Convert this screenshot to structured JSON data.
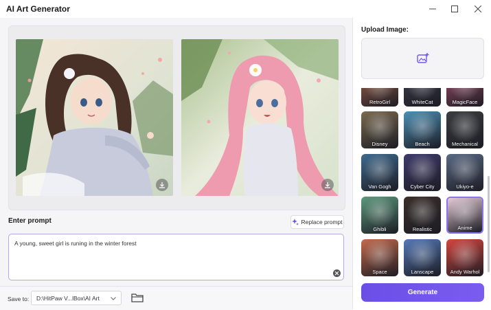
{
  "window": {
    "title": "AI Art Generator"
  },
  "prompt": {
    "label": "Enter prompt",
    "replace_label": "Replace prompt",
    "value": "A young, sweet girl is runing in the winter forest"
  },
  "save": {
    "label": "Save to:",
    "path": "D:\\HitPaw V...lBox\\AI Art"
  },
  "upload": {
    "label": "Upload Image:"
  },
  "styles": [
    {
      "name": "RetroGirl",
      "color": "#a2644c"
    },
    {
      "name": "WhiteCat",
      "color": "#3d3e4c"
    },
    {
      "name": "MagicFace",
      "color": "#a24f6b"
    },
    {
      "name": "Disney",
      "color": "#7b6a4f"
    },
    {
      "name": "Beach",
      "color": "#4b90b6"
    },
    {
      "name": "Mechanical",
      "color": "#3a3d40"
    },
    {
      "name": "Van Gogh",
      "color": "#3f6a8e"
    },
    {
      "name": "Cyber City",
      "color": "#3e3b6c"
    },
    {
      "name": "Ukiyo-e",
      "color": "#5a6a84"
    },
    {
      "name": "Ghibli",
      "color": "#5d9a7d"
    },
    {
      "name": "Realistic",
      "color": "#3a2f2a"
    },
    {
      "name": "Anime",
      "color": "#e5cbd7"
    },
    {
      "name": "Space",
      "color": "#c56b4c"
    },
    {
      "name": "Lanscape",
      "color": "#5479b8"
    },
    {
      "name": "Andy Warhol",
      "color": "#d7463e"
    }
  ],
  "selected_style": "Anime",
  "generate": {
    "label": "Generate"
  },
  "colors": {
    "accent": "#7356ee"
  }
}
